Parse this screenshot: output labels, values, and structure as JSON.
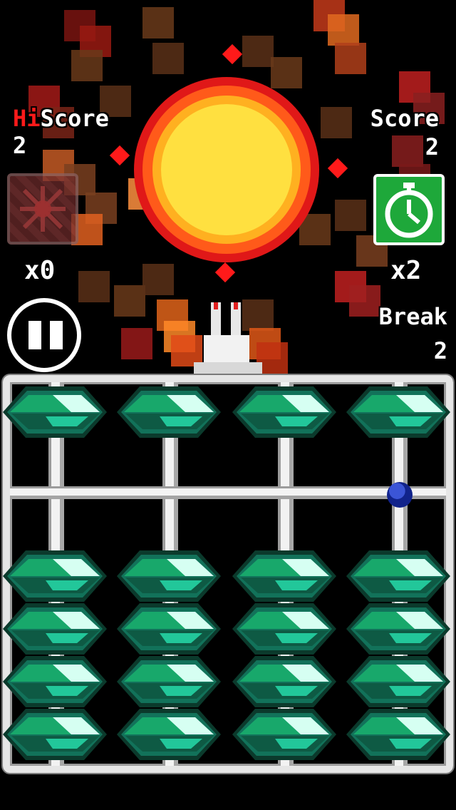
{
  "hud": {
    "hi_score_prefix": "Hi",
    "hi_score_label": "Score",
    "hi_score_value": "2",
    "score_label": "Score",
    "score_value": "2",
    "bomb_count": "x0",
    "clock_count": "x2",
    "break_label": "Break",
    "break_value": "2"
  },
  "icons": {
    "bomb_powerup": "bomb-icon",
    "clock_powerup": "clock-icon",
    "pause": "pause-icon",
    "ship": "ship-icon",
    "explosion": "explosion-icon"
  },
  "colors": {
    "background": "#000000",
    "bead_green": "#18a86b",
    "clock_box": "#1ea83a",
    "hi_prefix": "#ff1a1a",
    "abacus_frame": "#e6e6e6",
    "marker": "#1a2aa8"
  },
  "abacus": {
    "columns": 4,
    "upper_beads_per_column": 1,
    "lower_beads_per_column": 4
  }
}
